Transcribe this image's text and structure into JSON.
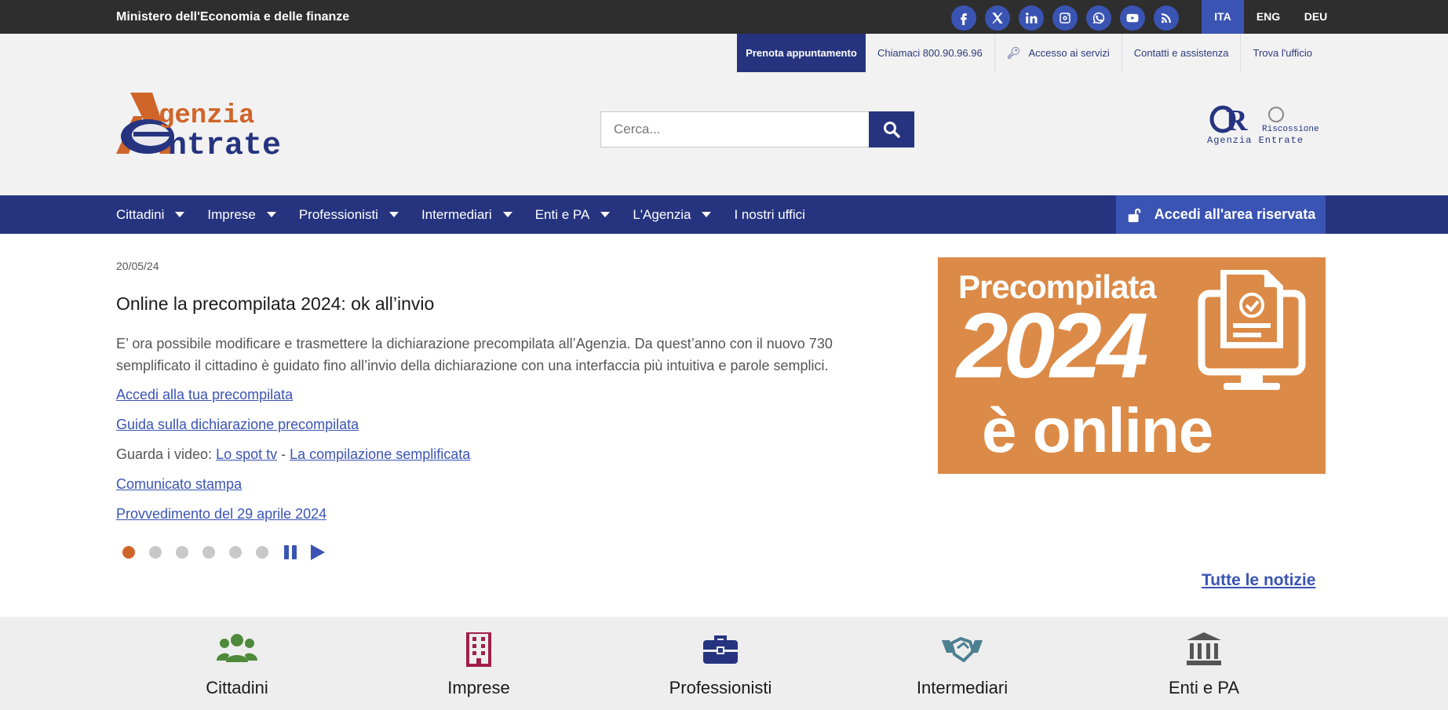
{
  "topbar": {
    "ministry": "Ministero dell'Economia e delle finanze",
    "socials": [
      "facebook-icon",
      "x-icon",
      "linkedin-icon",
      "instagram-icon",
      "whatsapp-icon",
      "youtube-icon",
      "rss-icon"
    ],
    "languages": [
      "ITA",
      "ENG",
      "DEU"
    ],
    "active_language": "ITA"
  },
  "utility": {
    "book": "Prenota appuntamento",
    "call": "Chiamaci 800.90.96.96",
    "services": "Accesso ai servizi",
    "contacts": "Contatti e assistenza",
    "office": "Trova l'ufficio"
  },
  "logo": {
    "line1": "genzia",
    "line2": "ntrate"
  },
  "search": {
    "placeholder": "Cerca..."
  },
  "ader": {
    "top": "Riscossione",
    "bottom": "Agenzia Entrate"
  },
  "nav": {
    "items": [
      "Cittadini",
      "Imprese",
      "Professionisti",
      "Intermediari",
      "Enti e PA",
      "L'Agenzia",
      "I nostri uffici"
    ],
    "reserved": "Accedi all'area riservata"
  },
  "news": {
    "date": "20/05/24",
    "title": "Online la precompilata 2024: ok all’invio",
    "body": "E’ ora possibile modificare e trasmettere la dichiarazione precompilata all’Agenzia. Da quest’anno con il nuovo 730 semplificato il cittadino è guidato fino all’invio della dichiarazione con una interfaccia più intuitiva e parole semplici.",
    "link1": "Accedi alla tua precompilata",
    "link2": "Guida sulla dichiarazione precompilata",
    "video_prefix": "Guarda i video: ",
    "video1": "Lo spot tv",
    "video_sep": " - ",
    "video2": "La compilazione semplificata",
    "link3": "Comunicato stampa",
    "link4": "Provvedimento del 29 aprile 2024",
    "slides_total": 6,
    "slide_active": 1,
    "all_news": "Tutte le notizie"
  },
  "banner": {
    "line1": "Precompilata",
    "line2": "2024",
    "line3": "è online",
    "bg_color": "#dc8a47"
  },
  "categories": [
    "Cittadini",
    "Imprese",
    "Professionisti",
    "Intermediari",
    "Enti e PA"
  ],
  "colors": {
    "primary": "#263480",
    "accent": "#3a54b4",
    "orange": "#d0652a"
  }
}
